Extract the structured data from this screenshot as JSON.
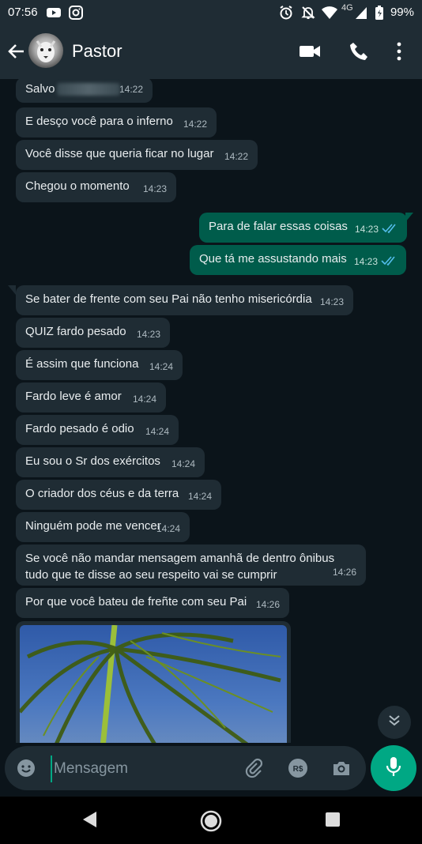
{
  "status": {
    "time": "07:56",
    "network": "4G",
    "battery": "99%",
    "icons": [
      "youtube-icon",
      "instagram-icon",
      "alarm-icon",
      "muted-bell-icon",
      "wifi-icon",
      "signal-icon",
      "battery-icon"
    ]
  },
  "header": {
    "contact_name": "Pastor",
    "icons": [
      "back-arrow-icon",
      "video-call-icon",
      "phone-icon",
      "more-vert-icon"
    ]
  },
  "messages": [
    {
      "dir": "in",
      "text": "Salvo",
      "time": "14:22",
      "redacted": true
    },
    {
      "dir": "in",
      "text": "E desço você para o inferno",
      "time": "14:22"
    },
    {
      "dir": "in",
      "text": "Você disse que queria ficar no lugar",
      "time": "14:22"
    },
    {
      "dir": "in",
      "text": "Chegou o momento",
      "time": "14:23"
    },
    {
      "dir": "out",
      "text": "Para de falar essas coisas",
      "time": "14:23",
      "status": "read"
    },
    {
      "dir": "out",
      "text": "Que tá me assustando mais",
      "time": "14:23",
      "status": "read"
    },
    {
      "dir": "in",
      "text": "Se bater de frente com seu Pai não tenho misericórdia",
      "time": "14:23"
    },
    {
      "dir": "in",
      "text": "QUIZ fardo pesado",
      "time": "14:23"
    },
    {
      "dir": "in",
      "text": "É assim que funciona",
      "time": "14:24"
    },
    {
      "dir": "in",
      "text": "Fardo leve é amor",
      "time": "14:24"
    },
    {
      "dir": "in",
      "text": "Fardo pesado é odio",
      "time": "14:24"
    },
    {
      "dir": "in",
      "text": "Eu sou o Sr dos exércitos",
      "time": "14:24"
    },
    {
      "dir": "in",
      "text": "O criador dos céus e da terra",
      "time": "14:24"
    },
    {
      "dir": "in",
      "text": "Ninguém pode me vencer",
      "time": "14:24"
    },
    {
      "dir": "in",
      "text": "Se você não mandar mensagem amanhã de dentro ônibus tudo que te disse ao seu respeito vai se cumprir",
      "time": "14:26"
    },
    {
      "dir": "in",
      "text": "Por que você bateu de freñte com seu Pai",
      "time": "14:26"
    }
  ],
  "composer": {
    "placeholder": "Mensagem",
    "icons": [
      "emoji-icon",
      "attach-icon",
      "payment-icon",
      "camera-icon",
      "mic-icon"
    ]
  },
  "colors": {
    "background": "#0b141a",
    "incoming": "#1f2c34",
    "outgoing": "#005c4b",
    "accent": "#00a884",
    "read_ticks": "#53bdeb"
  }
}
